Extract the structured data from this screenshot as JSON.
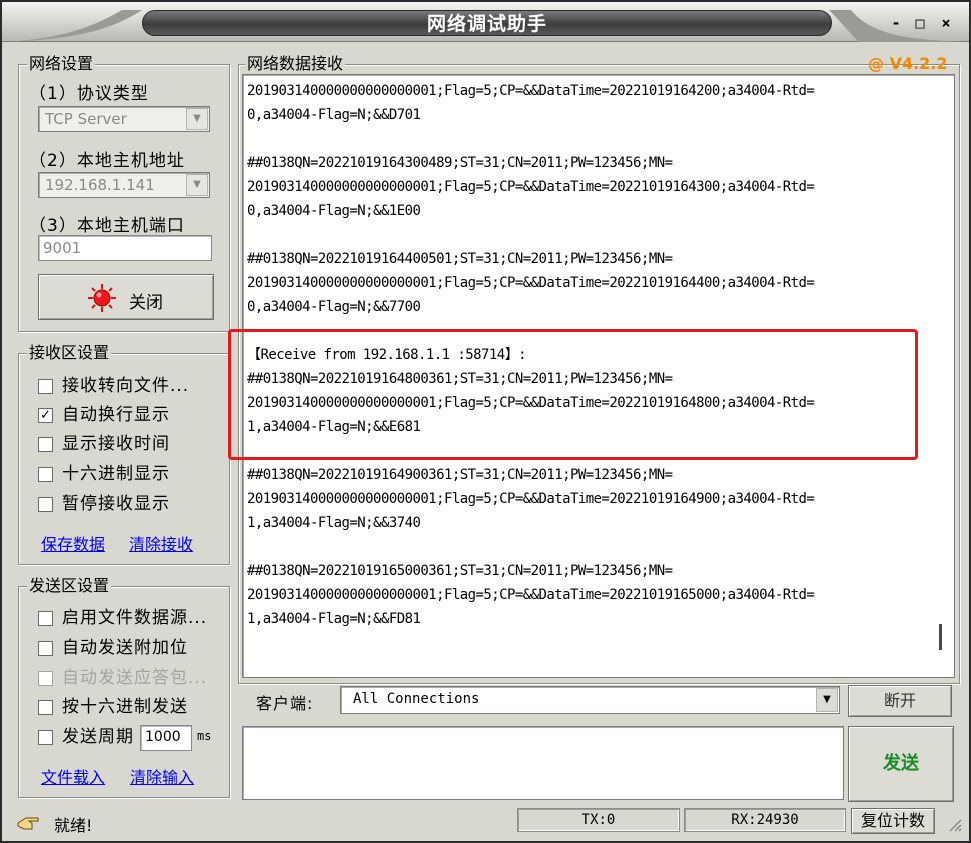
{
  "window": {
    "title": "网络调试助手",
    "version": "@ V4.2.2"
  },
  "net_settings": {
    "group_title": "网络设置",
    "protocol_label": "（1）协议类型",
    "protocol_value": "TCP Server",
    "host_label": "（2）本地主机地址",
    "host_value": "192.168.1.141",
    "port_label": "（3）本地主机端口",
    "port_value": "9001",
    "close_button": "关闭"
  },
  "recv_settings": {
    "group_title": "接收区设置",
    "options": [
      {
        "label": "接收转向文件...",
        "checked": false
      },
      {
        "label": "自动换行显示",
        "checked": true
      },
      {
        "label": "显示接收时间",
        "checked": false
      },
      {
        "label": "十六进制显示",
        "checked": false
      },
      {
        "label": "暂停接收显示",
        "checked": false
      }
    ],
    "save_link": "保存数据",
    "clear_link": "清除接收"
  },
  "send_settings": {
    "group_title": "发送区设置",
    "options": [
      {
        "label": "启用文件数据源...",
        "checked": false
      },
      {
        "label": "自动发送附加位",
        "checked": false
      },
      {
        "label": "自动发送应答包...",
        "checked": false
      },
      {
        "label": "按十六进制发送",
        "checked": false
      }
    ],
    "period_label": "发送周期",
    "period_value": "1000",
    "period_unit": "ms",
    "load_link": "文件载入",
    "clear_link": "清除输入"
  },
  "receive": {
    "group_title": "网络数据接收",
    "lines": [
      "201903140000000000000001;Flag=5;CP=&&DataTime=20221019164200;a34004-Rtd=",
      "0,a34004-Flag=N;&&D701",
      "",
      "##0138QN=20221019164300489;ST=31;CN=2011;PW=123456;MN=",
      "201903140000000000000001;Flag=5;CP=&&DataTime=20221019164300;a34004-Rtd=",
      "0,a34004-Flag=N;&&1E00",
      "",
      "##0138QN=20221019164400501;ST=31;CN=2011;PW=123456;MN=",
      "201903140000000000000001;Flag=5;CP=&&DataTime=20221019164400;a34004-Rtd=",
      "0,a34004-Flag=N;&&7700",
      "",
      "【Receive from 192.168.1.1 :58714】:",
      "##0138QN=20221019164800361;ST=31;CN=2011;PW=123456;MN=",
      "201903140000000000000001;Flag=5;CP=&&DataTime=20221019164800;a34004-Rtd=",
      "1,a34004-Flag=N;&&E681",
      "",
      "##0138QN=20221019164900361;ST=31;CN=2011;PW=123456;MN=",
      "201903140000000000000001;Flag=5;CP=&&DataTime=20221019164900;a34004-Rtd=",
      "1,a34004-Flag=N;&&3740",
      "",
      "##0138QN=20221019165000361;ST=31;CN=2011;PW=123456;MN=",
      "201903140000000000000001;Flag=5;CP=&&DataTime=20221019165000;a34004-Rtd=",
      "1,a34004-Flag=N;&&FD81"
    ]
  },
  "client": {
    "label": "客户端:",
    "value": "All Connections",
    "disconnect_button": "断开"
  },
  "send": {
    "button": "发送"
  },
  "status": {
    "text": "就绪!",
    "tx": "TX:0",
    "rx": "RX:24930",
    "reset_button": "复位计数"
  },
  "colors": {
    "highlight": "#e8191d",
    "version": "#f08a00",
    "send_button_text": "#1a8a2a"
  }
}
